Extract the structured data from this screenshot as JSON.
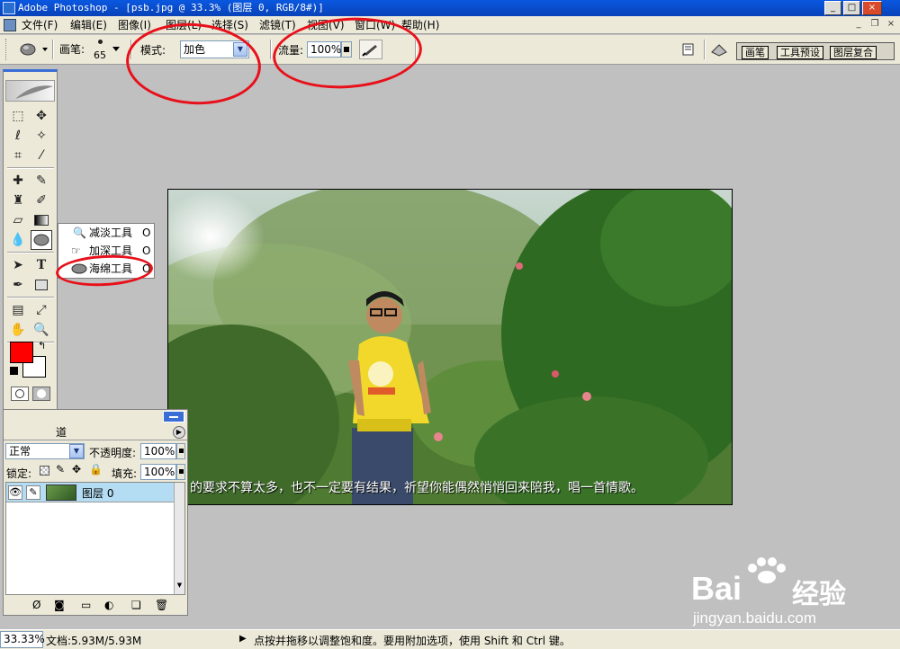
{
  "window": {
    "title": "Adobe Photoshop - [psb.jpg @ 33.3% (图层 0, RGB/8#)]",
    "controls": {
      "minimize": "_",
      "maximize": "□",
      "close": "×"
    }
  },
  "menu": {
    "items": [
      "文件(F)",
      "编辑(E)",
      "图像(I)",
      "图层(L)",
      "选择(S)",
      "滤镜(T)",
      "视图(V)",
      "窗口(W)",
      "帮助(H)"
    ],
    "mdi_controls": {
      "minimize": "_",
      "restore": "❐",
      "close": "×"
    }
  },
  "options": {
    "brush_label": "画笔:",
    "brush_size": "65",
    "mode_label": "模式:",
    "mode_value": "加色",
    "flow_label": "流量:",
    "flow_value": "100%",
    "tabs": [
      "画笔",
      "工具预设",
      "图层复合"
    ]
  },
  "flyout": {
    "items": [
      {
        "label": "减淡工具",
        "shortcut": "O"
      },
      {
        "label": "加深工具",
        "shortcut": "O"
      },
      {
        "label": "海绵工具",
        "shortcut": "O"
      }
    ]
  },
  "layers": {
    "tab_fragment": "道",
    "blend_mode": "正常",
    "opacity_label": "不透明度:",
    "opacity_value": "100%",
    "lock_label": "锁定:",
    "fill_label": "填充:",
    "fill_value": "100%",
    "layer_name": "图层 0"
  },
  "document": {
    "caption": "的要求不算太多，也不一定要有结果，祈望你能偶然悄悄回来陪我，唱一首情歌。"
  },
  "status": {
    "zoom": "33.33%",
    "doc_info": "文档:5.93M/5.93M",
    "hint": "点按并拖移以调整饱和度。要用附加选项，使用 Shift 和 Ctrl 键。"
  },
  "watermark": {
    "brand": "Bai",
    "brand_cn": "经验",
    "url": "jingyan.baidu.com"
  },
  "colors": {
    "foreground": "#ff0000",
    "background": "#ffffff",
    "annotation": "#e8101a"
  }
}
